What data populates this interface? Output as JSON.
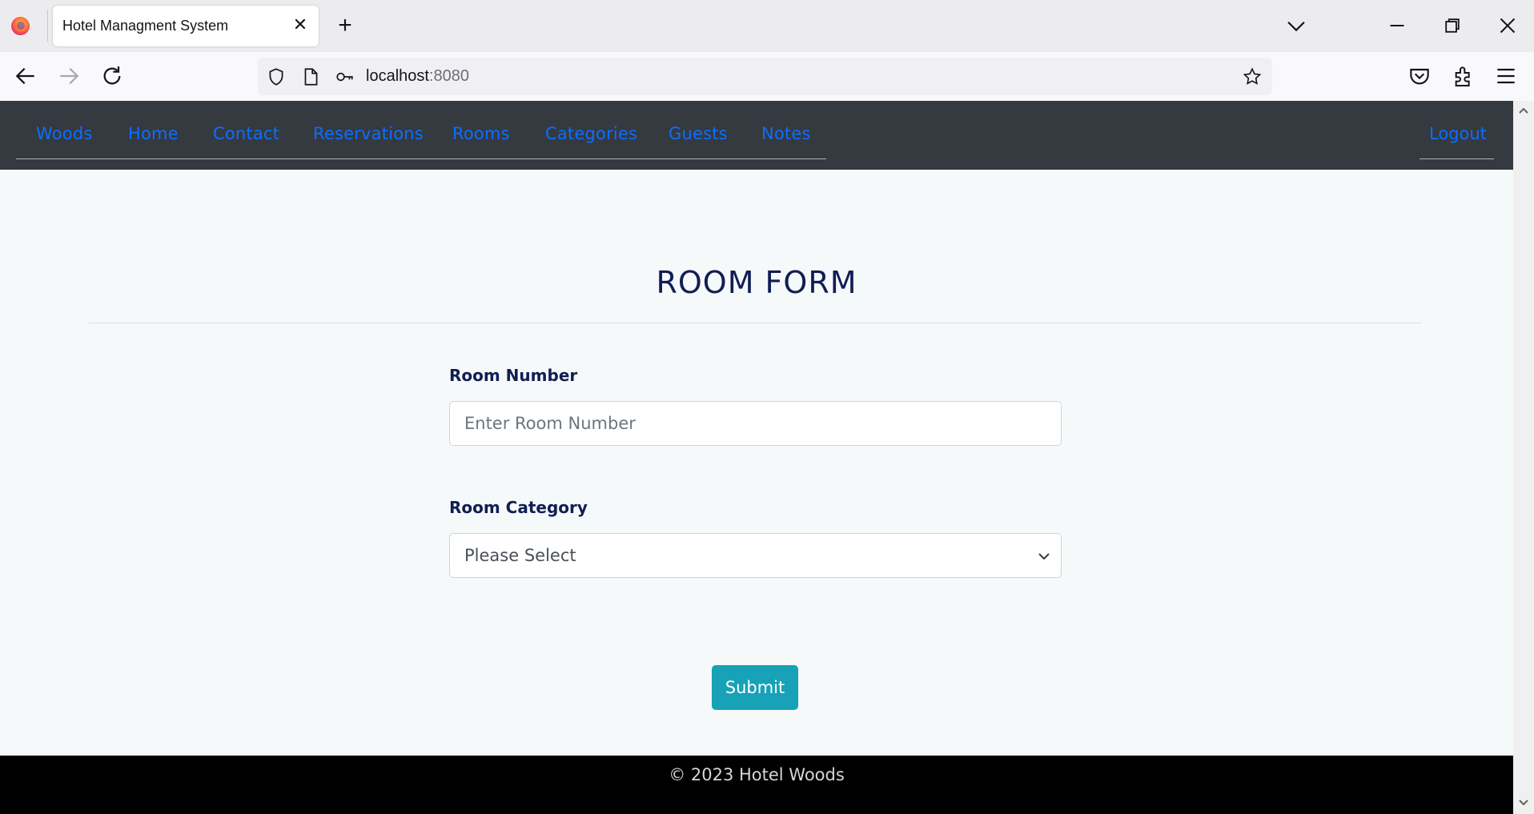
{
  "browser": {
    "tab_title": "Hotel Managment System",
    "url_host": "localhost",
    "url_port": ":8080",
    "icons": [
      "firefox-icon",
      "close-icon",
      "plus-icon",
      "chevron-down-icon",
      "minimize-icon",
      "restore-icon",
      "window-close-icon",
      "back-icon",
      "forward-icon",
      "reload-icon",
      "shield-icon",
      "page-icon",
      "key-icon",
      "star-icon",
      "pocket-icon",
      "extensions-icon",
      "menu-icon"
    ]
  },
  "site_nav": {
    "brand": "Woods",
    "links": [
      "Home",
      "Contact",
      "Reservations",
      "Rooms",
      "Categories",
      "Guests",
      "Notes"
    ],
    "logout": "Logout",
    "link_color": "#0d6efd",
    "bg_color": "#343a40"
  },
  "form": {
    "title": "ROOM FORM",
    "room_number_label": "Room Number",
    "room_number_placeholder": "Enter Room Number",
    "room_category_label": "Room Category",
    "room_category_selected": "Please Select",
    "submit_label": "Submit",
    "accent_color": "#17a2b8"
  },
  "footer": {
    "text": "© 2023 Hotel Woods"
  }
}
